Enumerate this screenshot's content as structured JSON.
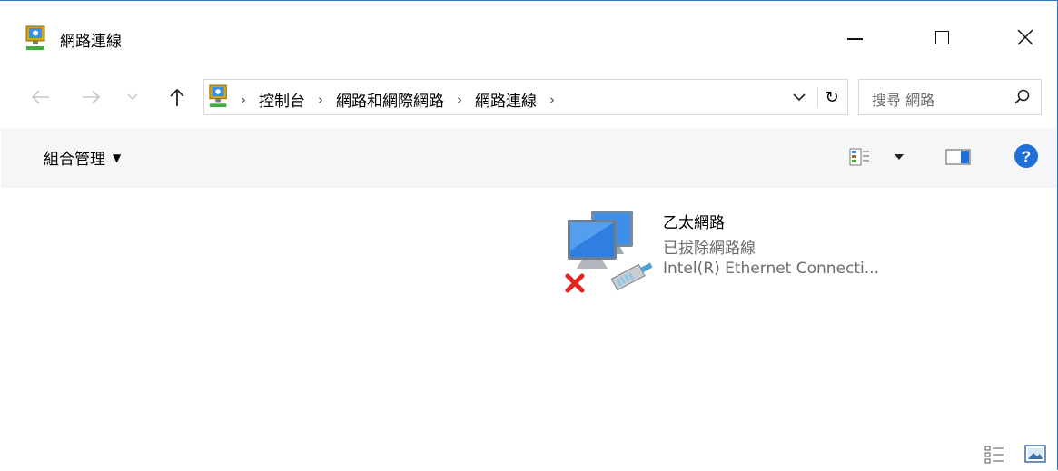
{
  "window": {
    "title": "網路連線"
  },
  "nav": {
    "back": "←",
    "forward": "→",
    "recent": "⌄",
    "up": "↑"
  },
  "address": {
    "separator": "›",
    "crumbs": [
      "控制台",
      "網路和網際網路",
      "網路連線"
    ],
    "refresh": "↻"
  },
  "search": {
    "placeholder": "搜尋 網路"
  },
  "toolbar": {
    "organize_label": "組合管理",
    "organize_caret": "▼"
  },
  "items": [
    {
      "name": "乙太網路",
      "status": "已拔除網路線",
      "device": "Intel(R) Ethernet Connecti..."
    }
  ],
  "icons": {
    "app": "network-connections-icon",
    "item": "ethernet-adapter-disconnected-icon",
    "help": "help-icon",
    "details_view": "details-view-icon",
    "large_view": "large-icons-view-icon"
  },
  "colors": {
    "accent": "#2b78c5",
    "help_blue": "#1e6fd9",
    "error_red": "#e3231c",
    "secondary_text": "#6d6d6d"
  }
}
